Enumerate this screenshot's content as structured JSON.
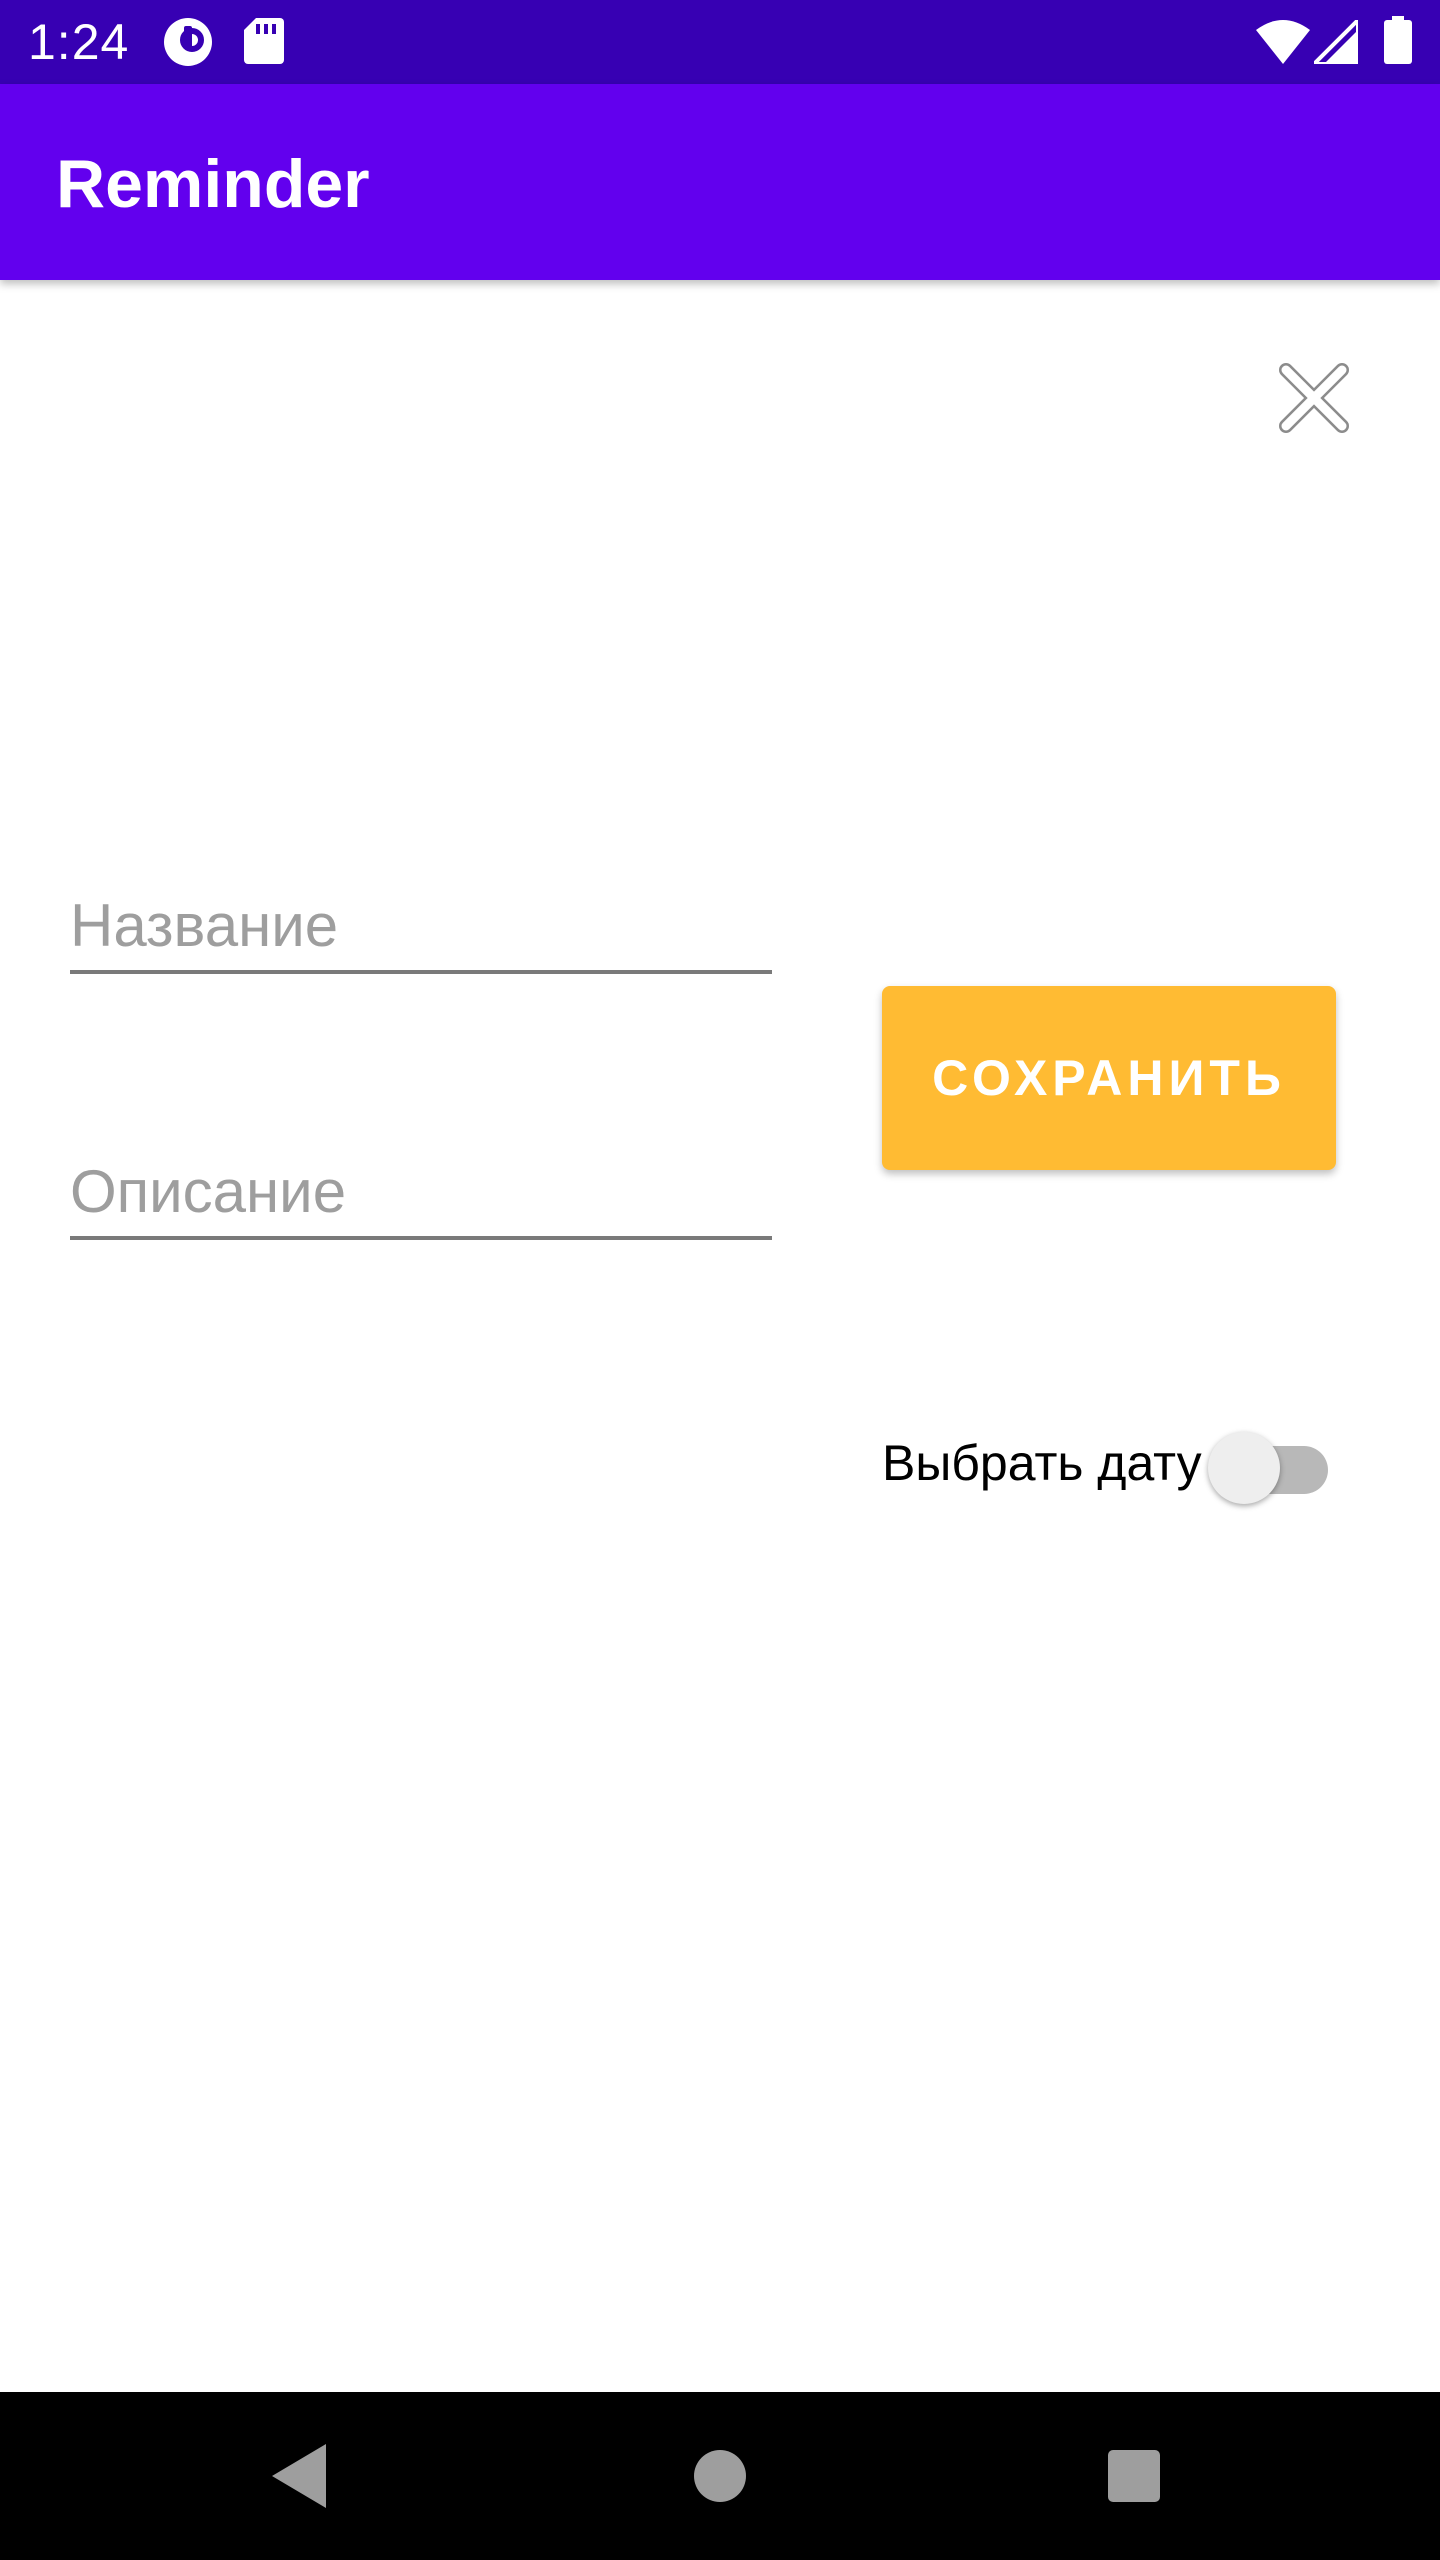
{
  "status_bar": {
    "time": "1:24",
    "icons": [
      "app-notification-icon",
      "sd-card-icon",
      "wifi-icon",
      "signal-icon",
      "battery-icon"
    ]
  },
  "app_bar": {
    "title": "Reminder"
  },
  "form": {
    "title_field": {
      "placeholder": "Название",
      "value": ""
    },
    "description_field": {
      "placeholder": "Описание",
      "value": ""
    },
    "save_label": "СОХРАНИТЬ",
    "date_toggle": {
      "label": "Выбрать дату",
      "checked": false
    }
  },
  "nav_bar": {
    "icons": [
      "back-icon",
      "home-icon",
      "recents-icon"
    ]
  },
  "colors": {
    "status_bar": "#3700b3",
    "app_bar": "#6200ee",
    "save_button": "#ffbb33"
  }
}
